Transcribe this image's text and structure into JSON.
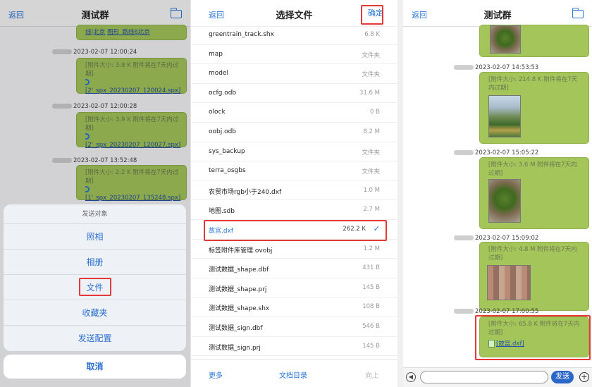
{
  "panel1": {
    "nav": {
      "back": "返回",
      "title": "测试群"
    },
    "top_bubble": {
      "link_left": "线|北京",
      "link_right": "图形_路线6北京"
    },
    "messages": [
      {
        "time": "2023-02-07 12:00:24",
        "head": "[附件大小: 3.9 K 附件将在7天内过期]",
        "file": "[2'_spx_20230207_120024.spx]"
      },
      {
        "time": "2023-02-07 12:00:28",
        "head": "[附件大小: 3.9 K 附件将在7天内过期]",
        "file": "[2'_spx_20230207_120027.spx]"
      },
      {
        "time": "2023-02-07 13:52:48",
        "head": "[附件大小: 2.2 K 附件将在7天内过期]",
        "file": "[1'_spx_20230207_135248.spx]"
      }
    ],
    "sheet": {
      "title": "发送对象",
      "options": [
        "照相",
        "相册",
        "文件",
        "收藏夹",
        "发送配置"
      ],
      "cancel": "取消"
    }
  },
  "panel2": {
    "nav": {
      "back": "返回",
      "title": "选择文件",
      "confirm": "确定"
    },
    "files": [
      {
        "name": "greentrain_track.shx",
        "size": "6.8 K"
      },
      {
        "name": "map",
        "size": "文件夹"
      },
      {
        "name": "model",
        "size": "文件夹"
      },
      {
        "name": "ocfg.odb",
        "size": "31.6 M"
      },
      {
        "name": "olock",
        "size": "0 B"
      },
      {
        "name": "oobj.odb",
        "size": "8.2 M"
      },
      {
        "name": "sys_backup",
        "size": "文件夹"
      },
      {
        "name": "terra_osgbs",
        "size": "文件夹"
      },
      {
        "name": "农贸市场rgb小于240.dxf",
        "size": "1.0 M"
      },
      {
        "name": "地图.sdb",
        "size": "2.7 M"
      },
      {
        "name": "故宫.dxf",
        "size": "262.2 K",
        "selected": true
      },
      {
        "name": "标签附件库管理.ovobj",
        "size": "1.2 M"
      },
      {
        "name": "测试数据_shape.dbf",
        "size": "431 B"
      },
      {
        "name": "测试数据_shape.prj",
        "size": "145 B"
      },
      {
        "name": "测试数据_shape.shx",
        "size": "108 B"
      },
      {
        "name": "测试数据_sign.dbf",
        "size": "546 B"
      },
      {
        "name": "测试数据_sign.prj",
        "size": "145 B"
      }
    ],
    "bottom": {
      "more": "更多",
      "docs": "文档目录",
      "up": "向上"
    }
  },
  "panel3": {
    "nav": {
      "back": "返回",
      "title": "测试群"
    },
    "messages": [
      {
        "time": "2023-02-07 14:53:53",
        "head": "[附件大小: 214.8 K 附件将在7天内过期]"
      },
      {
        "time": "2023-02-07 15:05:22",
        "head": "[附件大小: 3.6 M 附件将在7天内过期]"
      },
      {
        "time": "2023-02-07 15:09:02",
        "head": "[附件大小: 4.8 M 附件将在7天内过期]"
      },
      {
        "time": "2023-02-07 17:00:55",
        "head": "[附件大小: 65.8 K 附件将在7天内过期]",
        "file": "[故宫.dxf]"
      }
    ],
    "input": {
      "send": "发送",
      "plus": "+"
    }
  },
  "colors": {
    "bubble": "#a3c55a",
    "link": "#2b78d8",
    "highlight": "#e53935"
  }
}
